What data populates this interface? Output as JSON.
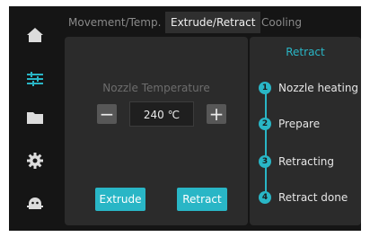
{
  "sidebar": {
    "items": [
      {
        "icon": "home-icon"
      },
      {
        "icon": "settings-sliders-icon",
        "active": true
      },
      {
        "icon": "folder-icon"
      },
      {
        "icon": "gear-icon"
      },
      {
        "icon": "robot-icon"
      }
    ]
  },
  "tabs": [
    {
      "label": "Movement/Temp."
    },
    {
      "label": "Extrude/Retract",
      "active": true
    },
    {
      "label": "Cooling"
    }
  ],
  "nozzle": {
    "label": "Nozzle Temperature",
    "value": "240 ℃",
    "minus_label": "−",
    "plus_label": "+"
  },
  "actions": {
    "extrude_label": "Extrude",
    "retract_label": "Retract"
  },
  "retract_panel": {
    "title": "Retract",
    "steps": [
      {
        "num": "1",
        "label": "Nozzle heating"
      },
      {
        "num": "2",
        "label": "Prepare"
      },
      {
        "num": "3",
        "label": "Retracting"
      },
      {
        "num": "4",
        "label": "Retract done"
      }
    ]
  },
  "colors": {
    "accent": "#29b6c6",
    "background": "#151515",
    "panel": "#2b2b2b"
  }
}
